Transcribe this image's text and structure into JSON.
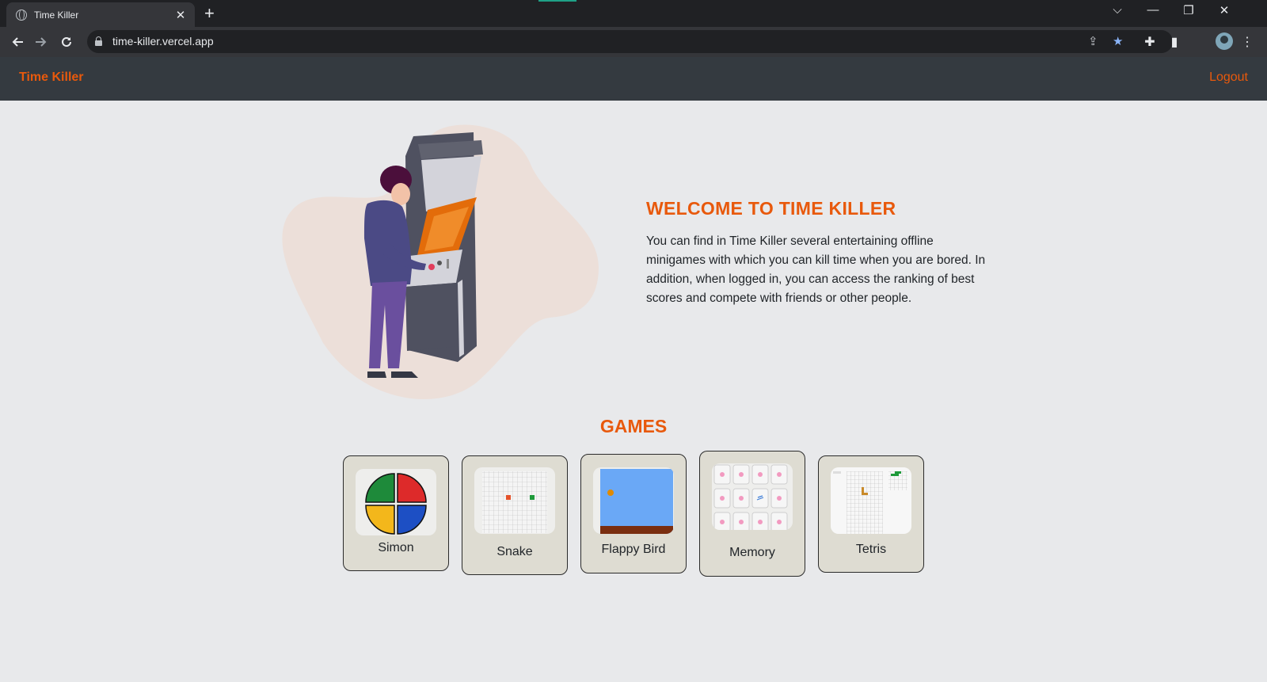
{
  "browser": {
    "tab_title": "Time Killer",
    "tab_close": "✕",
    "new_tab": "+",
    "url": "time-killer.vercel.app",
    "window_controls": {
      "tabsearch": "⌵",
      "minimize": "—",
      "restore": "❐",
      "close": "✕"
    },
    "icons": [
      "back-arrow-icon",
      "forward-arrow-icon",
      "reload-icon",
      "lock-icon",
      "share-icon",
      "bookmark-star-icon",
      "extensions-icon",
      "side-panel-icon",
      "profile-avatar",
      "kebab-menu-icon"
    ]
  },
  "app": {
    "brand": "Time Killer",
    "logout": "Logout",
    "accent_color": "#e8590c"
  },
  "hero": {
    "heading": "WELCOME TO TIME KILLER",
    "text": "You can find in Time Killer several entertaining offline minigames with which you can kill time when you are bored. In addition, when logged in, you can access the ranking of best scores and compete with friends or other people."
  },
  "games": {
    "title": "GAMES",
    "items": [
      {
        "name": "Simon"
      },
      {
        "name": "Snake"
      },
      {
        "name": "Flappy Bird"
      },
      {
        "name": "Memory"
      },
      {
        "name": "Tetris"
      }
    ]
  }
}
